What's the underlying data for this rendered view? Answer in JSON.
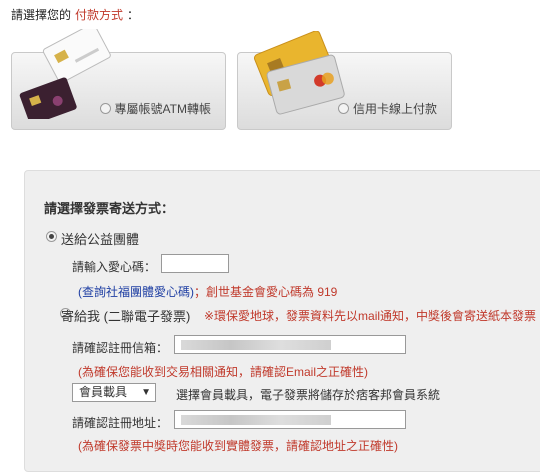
{
  "header": {
    "prefix": "請選擇您的",
    "accent": "付款方式",
    "suffix": "："
  },
  "payment_options": [
    {
      "label": "專屬帳號ATM轉帳",
      "icon": "atm-card-icon"
    },
    {
      "label": "信用卡線上付款",
      "icon": "credit-card-icon"
    }
  ],
  "invoice": {
    "title": "請選擇發票寄送方式：",
    "donate": {
      "label": "送給公益團體",
      "code_label": "請輸入愛心碼：",
      "code_value": "",
      "query_link": "(查詢社福團體愛心碼)",
      "note": "；創世基金會愛心碼為 919"
    },
    "send_me": {
      "label": "寄給我 (二聯電子發票)",
      "warning": "※環保愛地球，發票資料先以mail通知，中獎後會寄送紙本發票",
      "email_label": "請確認註冊信箱：",
      "email_note": "(為確保您能收到交易相關通知，請確認Email之正確性)",
      "carrier_select": "會員載具",
      "carrier_desc": "選擇會員載具，電子發票將儲存於痞客邦會員系統",
      "address_label": "請確認註冊地址：",
      "address_note": "(為確保發票中獎時您能收到實體發票，請確認地址之正確性)"
    }
  }
}
